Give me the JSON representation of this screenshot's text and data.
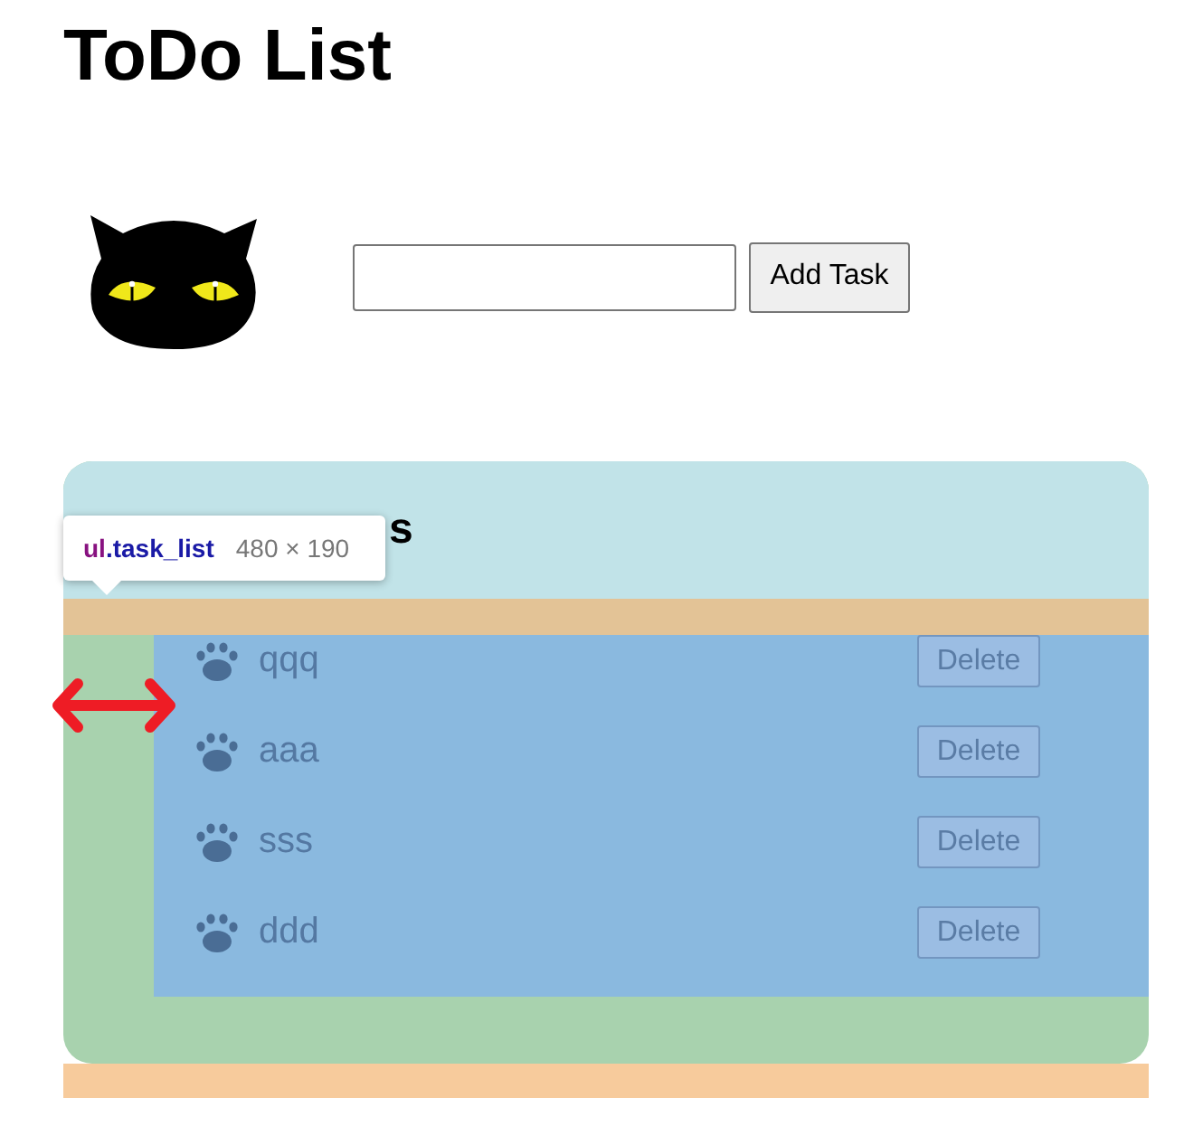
{
  "title": "ToDo List",
  "add_button": "Add Task",
  "section": {
    "heading": "s",
    "tasks": [
      {
        "text": "qqq",
        "delete_label": "Delete"
      },
      {
        "text": "aaa",
        "delete_label": "Delete"
      },
      {
        "text": "sss",
        "delete_label": "Delete"
      },
      {
        "text": "ddd",
        "delete_label": "Delete"
      }
    ]
  },
  "inspector_tooltip": {
    "selector": "ul.task_list",
    "size": "480 × 190"
  }
}
